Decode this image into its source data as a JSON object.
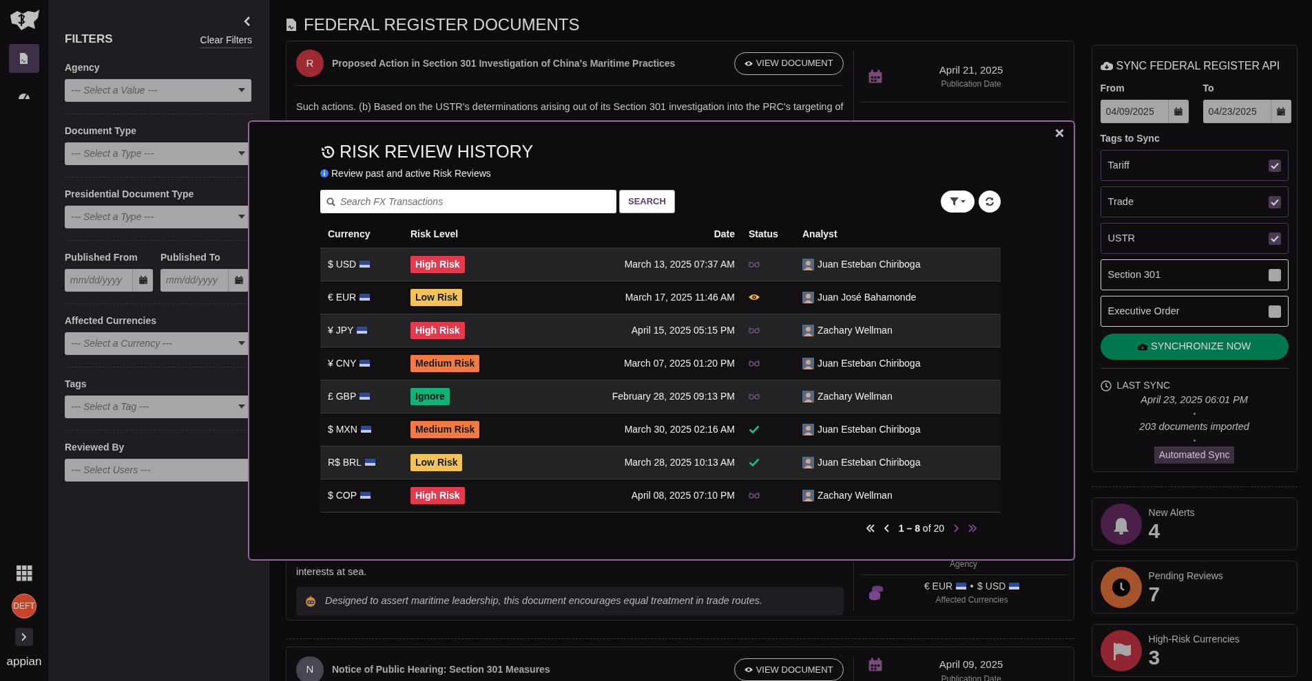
{
  "rail": {
    "nav_items": [
      {
        "kind": "documents",
        "selected": true
      },
      {
        "kind": "dashboard",
        "selected": false
      }
    ],
    "badge": "DEFT",
    "brand": "appian"
  },
  "filters": {
    "title": "FILTERS",
    "clear": "Clear Filters",
    "fields": [
      {
        "kind": "select",
        "label": "Agency",
        "placeholder": "--- Select a Value ---"
      },
      {
        "kind": "select",
        "label": "Document Type",
        "placeholder": "--- Select a Type ---"
      },
      {
        "kind": "select",
        "label": "Presidential Document Type",
        "placeholder": "--- Select a Type ---"
      },
      {
        "kind": "dates",
        "items": [
          {
            "label": "Published From",
            "placeholder": "mm/dd/yyyy"
          },
          {
            "label": "Published To",
            "placeholder": "mm/dd/yyyy"
          }
        ]
      },
      {
        "kind": "select",
        "label": "Affected Currencies",
        "placeholder": "--- Select a Currency ---"
      },
      {
        "kind": "select",
        "label": "Tags",
        "placeholder": "--- Select a Tag ---"
      },
      {
        "kind": "users",
        "label": "Reviewed By",
        "placeholder": "--- Select Users ---"
      }
    ]
  },
  "page_title": "FEDERAL REGISTER DOCUMENTS",
  "documents": [
    {
      "initial": "R",
      "color": "#9e2a33",
      "title": "Proposed Action in Section 301 Investigation of China's Maritime Practices",
      "button": "VIEW DOCUMENT",
      "excerpt_start": "Such actions. (b) Based on the USTR's determinations arising out of its Section 301 investigation into the PRC's targeting of",
      "excerpt_end": "interests at sea.",
      "summary": "Designed to assert maritime leadership, this document encourages equal treatment in trade routes.",
      "date": "April 21, 2025",
      "date_label": "Publication Date",
      "agency_label": "Agency",
      "currencies": [
        "€ EUR",
        "$ USD"
      ],
      "currencies_label": "Affected Currencies"
    },
    {
      "initial": "N",
      "color": "#4a4650",
      "title": "Notice of Public Hearing: Section 301 Measures",
      "button": "VIEW DOCUMENT",
      "date": "April 09, 2025",
      "date_label": "Publication Date"
    }
  ],
  "modal": {
    "title": "RISK REVIEW HISTORY",
    "subtitle": "Review past and active Risk Reviews",
    "search_placeholder": "Search FX Transactions",
    "search_button": "SEARCH",
    "columns": [
      "Currency",
      "Risk Level",
      "Date",
      "Status",
      "Analyst"
    ],
    "rows": [
      {
        "currency": "$ USD",
        "risk": {
          "label": "High Risk",
          "kind": "high"
        },
        "date": "March 13, 2025 07:37 AM",
        "status": {
          "kind": "pending"
        },
        "analyst": "Juan Esteban Chiriboga"
      },
      {
        "currency": "€ EUR",
        "risk": {
          "label": "Low Risk",
          "kind": "low"
        },
        "date": "March 17, 2025 11:46 AM",
        "status": {
          "kind": "viewing"
        },
        "analyst": "Juan José Bahamonde"
      },
      {
        "currency": "¥ JPY",
        "risk": {
          "label": "High Risk",
          "kind": "high"
        },
        "date": "April 15, 2025 05:15 PM",
        "status": {
          "kind": "pending"
        },
        "analyst": "Zachary Wellman"
      },
      {
        "currency": "¥ CNY",
        "risk": {
          "label": "Medium Risk",
          "kind": "medium"
        },
        "date": "March 07, 2025 01:20 PM",
        "status": {
          "kind": "pending"
        },
        "analyst": "Juan Esteban Chiriboga"
      },
      {
        "currency": "£ GBP",
        "risk": {
          "label": "Ignore",
          "kind": "ignore"
        },
        "date": "February 28, 2025 09:13 PM",
        "status": {
          "kind": "pending"
        },
        "analyst": "Zachary Wellman"
      },
      {
        "currency": "$ MXN",
        "risk": {
          "label": "Medium Risk",
          "kind": "medium"
        },
        "date": "March 30, 2025 02:16 AM",
        "status": {
          "kind": "done"
        },
        "analyst": "Juan Esteban Chiriboga"
      },
      {
        "currency": "R$ BRL",
        "risk": {
          "label": "Low Risk",
          "kind": "low"
        },
        "date": "March 28, 2025 10:13 AM",
        "status": {
          "kind": "done"
        },
        "analyst": "Juan Esteban Chiriboga"
      },
      {
        "currency": "$ COP",
        "risk": {
          "label": "High Risk",
          "kind": "high"
        },
        "date": "April 08, 2025 07:10 PM",
        "status": {
          "kind": "pending"
        },
        "analyst": "Zachary Wellman"
      }
    ],
    "pagination": "**1 – 8** of 20"
  },
  "sync": {
    "title": "SYNC FEDERAL REGISTER API",
    "from": {
      "label": "From",
      "value": "04/09/2025"
    },
    "to": {
      "label": "To",
      "value": "04/23/2025"
    },
    "tags_label": "Tags to Sync",
    "tags": [
      {
        "label": "Tariff",
        "checked": true
      },
      {
        "label": "Trade",
        "checked": true
      },
      {
        "label": "USTR",
        "checked": true
      },
      {
        "label": "Section 301",
        "checked": false
      },
      {
        "label": "Executive Order",
        "checked": false
      }
    ],
    "button": "SYNCHRONIZE NOW",
    "last_sync_label": "LAST SYNC",
    "last_sync_time": "April 23, 2025 06:01 PM",
    "documents_imported": "203 documents imported",
    "mode": "Automated Sync"
  },
  "stats": [
    {
      "kind": "alerts",
      "color": "#4a1f48",
      "label": "New Alerts",
      "value": "4"
    },
    {
      "kind": "pending",
      "color": "#a4532b",
      "label": "Pending Reviews",
      "value": "7"
    },
    {
      "kind": "flag",
      "color": "#8f2530",
      "label": "High-Risk Currencies",
      "value": "3"
    }
  ]
}
